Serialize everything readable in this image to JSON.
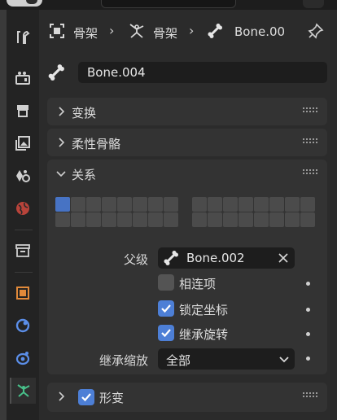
{
  "breadcrumb": {
    "item1": "骨架",
    "item2": "骨架",
    "item3": "Bone.00"
  },
  "bone_name": "Bone.004",
  "panels": {
    "transform": "变换",
    "bendy_bones": "柔性骨骼",
    "relations": "关系",
    "deform": "形变"
  },
  "relations": {
    "parent_label": "父级",
    "parent_value": "Bone.002",
    "connected_label": "相连项",
    "connected_checked": false,
    "local_location_label": "锁定坐标",
    "local_location_checked": true,
    "inherit_rotation_label": "继承旋转",
    "inherit_rotation_checked": true,
    "inherit_scale_label": "继承缩放",
    "inherit_scale_value": "全部",
    "bone_layers_active": [
      0
    ]
  },
  "deform_checked": true,
  "colors": {
    "accent": "#4d7fd6",
    "panel": "#333333",
    "field": "#1d1d1d"
  },
  "tab_icons": [
    "tool-icon",
    "render-icon",
    "output-icon",
    "view-layer-icon",
    "scene-icon",
    "world-icon",
    "collection-icon",
    "object-icon",
    "modifier-icon",
    "physics-icon",
    "armature-data-icon"
  ]
}
